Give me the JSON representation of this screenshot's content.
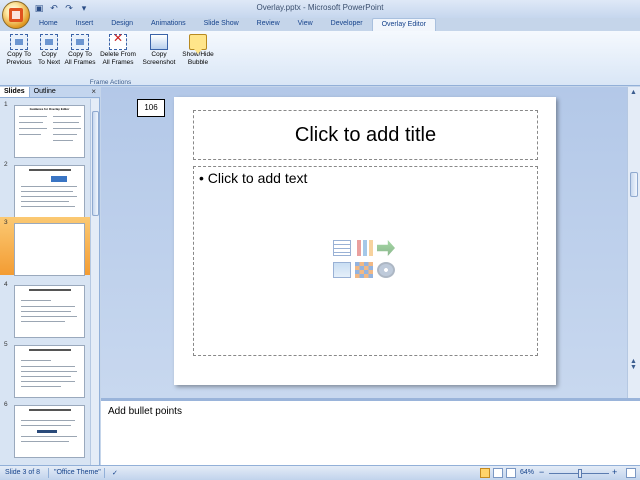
{
  "window": {
    "title": "Overlay.pptx - Microsoft PowerPoint"
  },
  "ribbon": {
    "tabs": [
      "Home",
      "Insert",
      "Design",
      "Animations",
      "Slide Show",
      "Review",
      "View",
      "Developer",
      "Overlay Editor"
    ],
    "active_tab": "Overlay Editor",
    "group_label": "Frame Actions",
    "buttons": [
      {
        "line1": "Copy To",
        "line2": "Previous",
        "icon": "frame-copy-icon"
      },
      {
        "line1": "Copy",
        "line2": "To Next",
        "icon": "frame-copy-icon"
      },
      {
        "line1": "Copy To",
        "line2": "All Frames",
        "icon": "frame-copy-icon"
      },
      {
        "line1": "Delete From",
        "line2": "All Frames",
        "icon": "delete-frame-icon"
      },
      {
        "line1": "Copy",
        "line2": "Screenshot",
        "icon": "screenshot-icon"
      },
      {
        "line1": "Show/Hide",
        "line2": "Bubble",
        "icon": "bubble-icon"
      }
    ]
  },
  "left_pane": {
    "tabs": [
      "Slides",
      "Outline"
    ],
    "active_tab": "Slides",
    "close_label": "×",
    "thumbnails": [
      {
        "number": "1",
        "title": "Guidance for Overlay Editor"
      },
      {
        "number": "2"
      },
      {
        "number": "3",
        "selected": true
      },
      {
        "number": "4"
      },
      {
        "number": "5"
      },
      {
        "number": "6"
      }
    ]
  },
  "slide": {
    "frame_counter": "106",
    "title_placeholder": "Click to add title",
    "body_placeholder": "• Click to add text"
  },
  "notes": {
    "text": "Add bullet points"
  },
  "status_bar": {
    "slide_info": "Slide 3 of 8",
    "theme": "\"Office Theme\"",
    "zoom": "64%",
    "zoom_out": "−",
    "zoom_in": "+"
  },
  "colors": {
    "ribbon_blue": "#c5d5ea",
    "selected_thumb": "#f39c33",
    "tab_text": "#15428b"
  }
}
